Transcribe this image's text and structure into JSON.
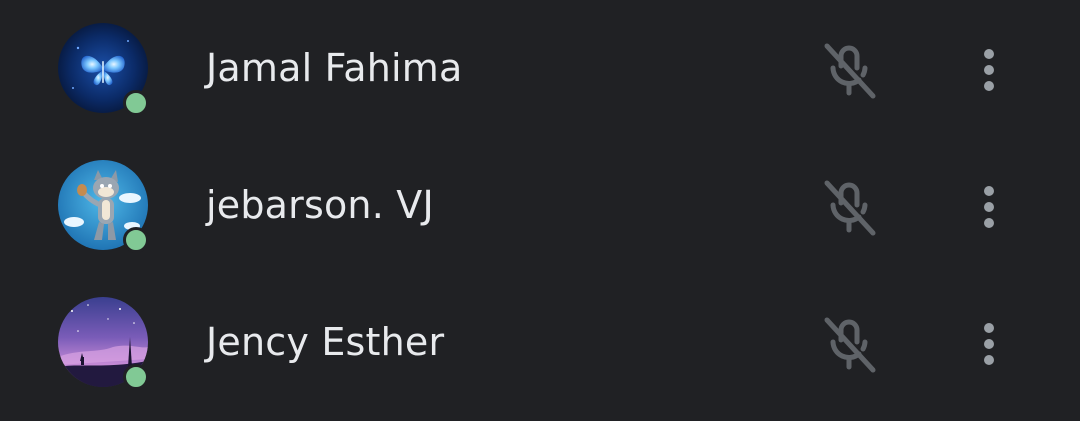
{
  "participants": [
    {
      "name": "Jamal Fahima",
      "avatar_icon": "blue-butterfly-avatar",
      "presence": "online",
      "mic_icon": "mic-off-icon",
      "menu_icon": "more-vert-icon"
    },
    {
      "name": "jebarson. VJ",
      "avatar_icon": "cartoon-cat-avatar",
      "presence": "online",
      "mic_icon": "mic-off-icon",
      "menu_icon": "more-vert-icon"
    },
    {
      "name": "Jency Esther",
      "avatar_icon": "starry-sky-avatar",
      "presence": "online",
      "mic_icon": "mic-off-icon",
      "menu_icon": "more-vert-icon"
    }
  ],
  "colors": {
    "background": "#202124",
    "text": "#e8eaed",
    "icon": "#9aa0a6",
    "muted_icon": "#5f6368",
    "presence": "#81c995"
  }
}
